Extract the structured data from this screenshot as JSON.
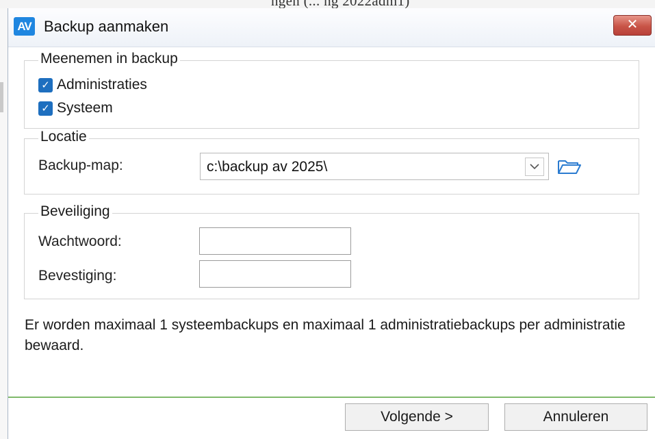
{
  "background": {
    "window_fragment_text": "ngen (... ng 2022adm1)"
  },
  "dialog": {
    "app_icon_text": "AV",
    "title": "Backup aanmaken",
    "close_label": "✕",
    "include_group": {
      "legend": "Meenemen in backup",
      "items": [
        {
          "label": "Administraties",
          "checked": true
        },
        {
          "label": "Systeem",
          "checked": true
        }
      ]
    },
    "location_group": {
      "legend": "Locatie",
      "field_label": "Backup-map:",
      "value": "c:\\backup av 2025\\"
    },
    "security_group": {
      "legend": "Beveiliging",
      "password_label": "Wachtwoord:",
      "password_value": "",
      "confirm_label": "Bevestiging:",
      "confirm_value": ""
    },
    "info_text": "Er worden maximaal 1 systeembackups en maximaal 1 administratiebackups per administratie bewaard.",
    "buttons": {
      "next": "Volgende >",
      "cancel": "Annuleren"
    }
  },
  "colors": {
    "accent": "#1e6fbf",
    "close": "#c85447",
    "footer_separator": "#7fb96a"
  },
  "icons": {
    "close": "close-icon",
    "checkbox": "checkmark-icon",
    "dropdown": "chevron-down-icon",
    "browse": "folder-open-icon"
  }
}
